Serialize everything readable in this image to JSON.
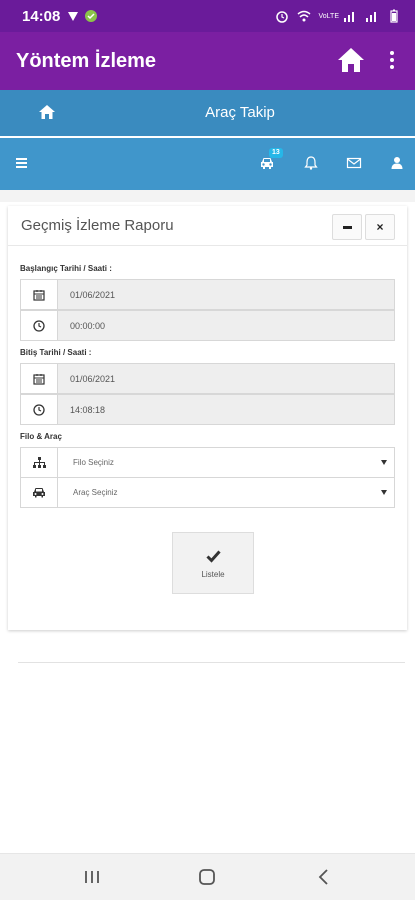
{
  "status_bar": {
    "time": "14:08",
    "network": "VoLTE",
    "colors": {
      "background": "#6a1b9a"
    }
  },
  "app_bar": {
    "title": "Yöntem İzleme",
    "home_icon": "home-icon",
    "menu_icon": "more-vert-icon",
    "colors": {
      "background": "#7b1fa2"
    }
  },
  "site_header": {
    "brand": "Araç Takip",
    "home_icon": "home-icon",
    "colors": {
      "background": "#3a8bbf"
    }
  },
  "nav": {
    "menu_icon": "hamburger-icon",
    "vehicle_badge": "13",
    "icons": [
      "car-icon",
      "bell-icon",
      "envelope-icon",
      "user-icon"
    ],
    "colors": {
      "background": "#4096cb",
      "badge": "#26b7e8"
    }
  },
  "report": {
    "title": "Geçmiş İzleme Raporu",
    "start_label": "Başlangıç Tarihi / Saati :",
    "start_date": "01/06/2021",
    "start_time": "00:00:00",
    "end_label": "Bitiş Tarihi / Saati :",
    "end_date": "01/06/2021",
    "end_time": "14:08:18",
    "fleet_label": "Filo & Araç",
    "fleet_select": "Filo Seçiniz",
    "vehicle_select": "Araç Seçiniz",
    "list_button": "Listele"
  }
}
